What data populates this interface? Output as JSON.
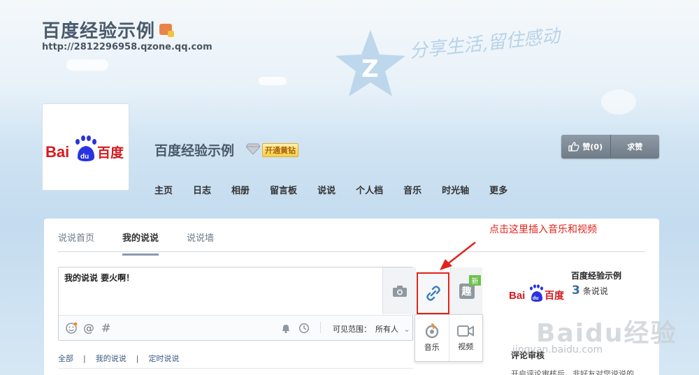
{
  "header": {
    "site_title": "百度经验示例",
    "site_url": "http://2812296958.qzone.qq.com",
    "slogan": "分享生活,留住感动"
  },
  "profile": {
    "logo_text_bai": "Bai",
    "logo_text_du": "du",
    "logo_text_cn": "百度",
    "owner_name": "百度经验示例",
    "vip_label": "开通黄钻"
  },
  "nav": {
    "items": [
      "主页",
      "日志",
      "相册",
      "留言板",
      "说说",
      "个人档",
      "音乐",
      "时光轴",
      "更多"
    ]
  },
  "like": {
    "like_label": "赞(0)",
    "ask_label": "求赞"
  },
  "tabs": {
    "items": [
      "说说首页",
      "我的说说",
      "说说墙"
    ],
    "active": "我的说说"
  },
  "composer": {
    "text": "我的说说 要火啊！",
    "new_badge": "新",
    "fun_label": "趣",
    "visibility_label": "可见范围：",
    "visibility_value": "所有人"
  },
  "popup": {
    "music_label": "音乐",
    "video_label": "视频"
  },
  "annotation": "点击这里插入音乐和视频",
  "filters": {
    "all": "全部",
    "mine": "我的说说",
    "scheduled": "定时说说",
    "sep": "|"
  },
  "sidebar": {
    "name": "百度经验示例",
    "count": "3",
    "count_unit": "条说说",
    "comment_title": "评论审核",
    "comment_text": "开启评论审核后，非好友对您说说的"
  },
  "watermark": {
    "main": "Baidu经验",
    "sub": "jingyan.baidu.com"
  },
  "colors": {
    "accent_red": "#e0241a",
    "nav_blue": "#3b5a80",
    "baidu_red": "#d7191e",
    "baidu_blue": "#2932e1"
  }
}
